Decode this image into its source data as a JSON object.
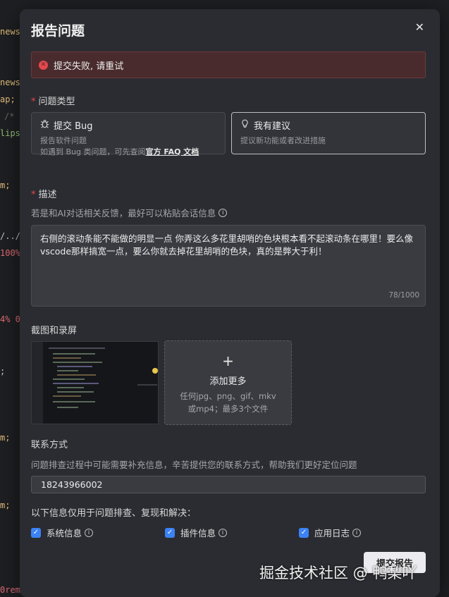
{
  "background_code": [
    "news",
    "news",
    "ap;",
    "/*",
    "lips",
    "m;",
    "/../",
    "100%",
    "4% 0",
    ";",
    "m;",
    "m;",
    "0rem,"
  ],
  "dialog": {
    "title": "报告问题",
    "close_label": "✕",
    "error": {
      "icon": "error-circle-icon",
      "message": "提交失败, 请重试"
    },
    "issue_type": {
      "label": "问题类型",
      "options": [
        {
          "title": "提交 Bug",
          "icon": "bug-icon",
          "desc_line1": "报告软件问题",
          "desc_line2_prefix": "如遇到 Bug 类问题，可先查阅",
          "desc_link": "官方 FAQ 文档"
        },
        {
          "title": "我有建议",
          "icon": "lightbulb-icon",
          "desc_line1": "提议新功能或者改进措施"
        }
      ]
    },
    "description": {
      "label": "描述",
      "hint": "若是和AI对话相关反馈，最好可以粘贴会话信息",
      "value": "右侧的滚动条能不能做的明显一点 你弄这么多花里胡哨的色块根本看不起滚动条在哪里！要么像vscode那样搞宽一点，要么你就去掉花里胡哨的色块，真的是弊大于利！",
      "counter": "78/1000"
    },
    "screenshots": {
      "label": "截图和录屏",
      "add_title": "添加更多",
      "add_desc_line1": "任何jpg、png、gif、mkv",
      "add_desc_line2": "或mp4；最多3个文件"
    },
    "contact": {
      "label": "联系方式",
      "hint": "问题排查过程中可能需要补充信息，辛苦提供您的联系方式，帮助我们更好定位问题",
      "value": "18243966002"
    },
    "info_usage": {
      "label": "以下信息仅用于问题排查、复现和解决：",
      "checkboxes": [
        {
          "label": "系统信息",
          "checked": true
        },
        {
          "label": "插件信息",
          "checked": true
        },
        {
          "label": "应用日志",
          "checked": true
        }
      ]
    },
    "submit_label": "提交报告"
  },
  "watermark": "掘金技术社区 @ 鸭梨吖",
  "colors": {
    "dialog_bg": "#2b2c31",
    "error_bg": "#4a2b2d",
    "accent": "#3b82f6",
    "required": "#e5484d"
  }
}
